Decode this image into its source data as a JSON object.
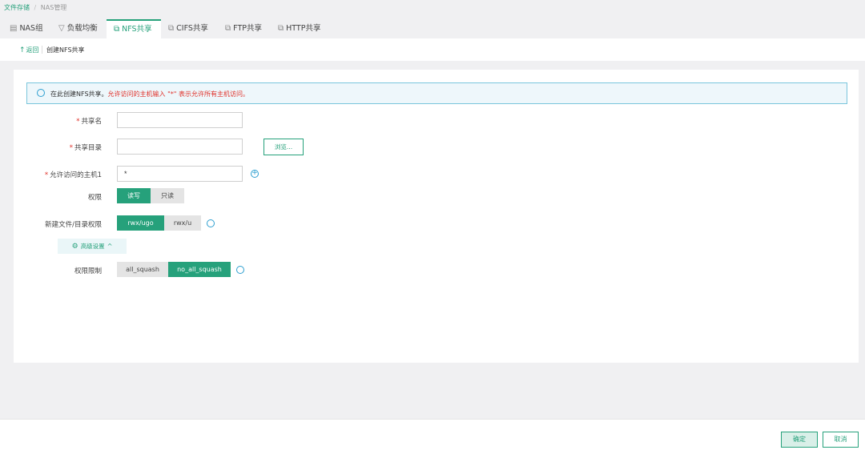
{
  "breadcrumb": {
    "root": "文件存储",
    "separator": "/",
    "current": "NAS管理"
  },
  "tabs": [
    {
      "label": "NAS组",
      "icon": "server-icon"
    },
    {
      "label": "负载均衡",
      "icon": "filter-icon"
    },
    {
      "label": "NFS共享",
      "icon": "share-icon",
      "active": true
    },
    {
      "label": "CIFS共享",
      "icon": "share-icon"
    },
    {
      "label": "FTP共享",
      "icon": "share-icon"
    },
    {
      "label": "HTTP共享",
      "icon": "share-icon"
    }
  ],
  "subbar": {
    "back_label": "返回",
    "page_title": "创建NFS共享"
  },
  "info": {
    "main": "在此创建NFS共享。",
    "warning": "允许访问的主机输入 \"*\" 表示允许所有主机访问。"
  },
  "form": {
    "share_name": {
      "label": "共享名",
      "required": true,
      "value": ""
    },
    "share_dir": {
      "label": "共享目录",
      "required": true,
      "value": "",
      "browse_label": "浏览..."
    },
    "host": {
      "label": "允许访问的主机1",
      "required": true,
      "value": "*"
    },
    "permission": {
      "label": "权限",
      "options": [
        "读写",
        "只读"
      ],
      "selected": "读写"
    },
    "file_perm": {
      "label": "新建文件/目录权限",
      "options": [
        "rwx/ugo",
        "rwx/u"
      ],
      "selected": "rwx/ugo"
    },
    "advanced": {
      "label": "高级设置"
    },
    "squash": {
      "label": "权限限制",
      "options": [
        "all_squash",
        "no_all_squash"
      ],
      "selected": "no_all_squash"
    }
  },
  "footer": {
    "ok_label": "确定",
    "cancel_label": "取消"
  },
  "colors": {
    "accent": "#26a17b",
    "info_border": "#7ac5dc",
    "warning": "#e0312a"
  }
}
